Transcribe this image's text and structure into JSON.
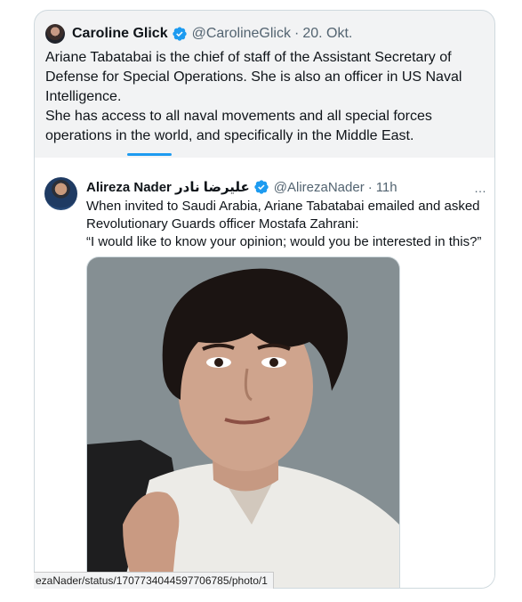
{
  "outer_tweet": {
    "display_name": "Caroline Glick",
    "handle": "@CarolineGlick",
    "separator": "·",
    "date": "20. Okt.",
    "text_paragraphs": [
      "Ariane Tabatabai is the chief of staff of the Assistant Secretary of Defense for Special Operations. She is also an officer in US Naval Intelligence.",
      "She has access to all naval movements and all special forces operations in the world, and specifically in the Middle East."
    ]
  },
  "quoted_tweet": {
    "display_name": "Alireza Nader علیرضا نادر",
    "handle": "@AlirezaNader",
    "separator": "·",
    "time": "11h",
    "more_icon": "…",
    "text_paragraphs": [
      "When invited to Saudi Arabia, Ariane Tabatabai emailed and asked Revolutionary Guards officer Mostafa Zahrani:",
      "“I would like to know your opinion; would you be interested in this?”"
    ]
  },
  "status_bar": {
    "url": "ezaNader/status/1707734044597706785/photo/1"
  },
  "colors": {
    "accent": "#1d9bf0",
    "outer_bg": "#f2f3f4",
    "text": "#0f1419",
    "muted": "#536471"
  },
  "icons": [
    "verified-badge-icon",
    "more-options-icon"
  ]
}
